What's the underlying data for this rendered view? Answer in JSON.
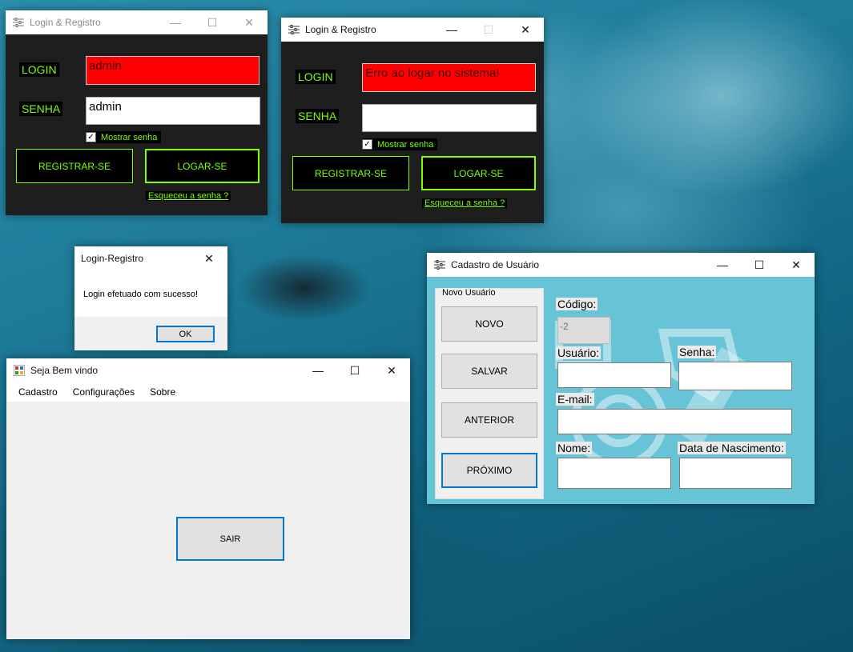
{
  "login1": {
    "title": "Login & Registro",
    "login_label": "LOGIN",
    "senha_label": "SENHA",
    "login_value": "admin",
    "senha_value": "admin",
    "show_password": "Mostrar senha",
    "register": "REGISTRAR-SE",
    "login_btn": "LOGAR-SE",
    "forgot": "Esqueceu a senha ?"
  },
  "login2": {
    "title": "Login & Registro",
    "login_label": "LOGIN",
    "senha_label": "SENHA",
    "login_value": "Erro ao logar no sistema!",
    "senha_value": "",
    "show_password": "Mostrar senha",
    "register": "REGISTRAR-SE",
    "login_btn": "LOGAR-SE",
    "forgot": "Esqueceu a senha ?"
  },
  "msgbox": {
    "title": "Login-Registro",
    "message": "Login efetuado com sucesso!",
    "ok": "OK"
  },
  "welcome": {
    "title": "Seja Bem vindo",
    "menu": [
      "Cadastro",
      "Configurações",
      "Sobre"
    ],
    "exit": "SAIR"
  },
  "cadastro": {
    "title": "Cadastro de Usuário",
    "group_title": "Novo Usuário",
    "buttons": {
      "novo": "NOVO",
      "salvar": "SALVAR",
      "anterior": "ANTERIOR",
      "proximo": "PRÓXIMO"
    },
    "labels": {
      "codigo": "Código:",
      "usuario": "Usuário:",
      "senha": "Senha:",
      "email": "E-mail:",
      "nome": "Nome:",
      "nascimento": "Data de Nascimento:"
    },
    "codigo_value": "-2"
  },
  "colors": {
    "accent_green": "#7fff00",
    "error_red": "#ff0000",
    "focus_blue": "#0078d7",
    "form_bg": "#67c3d6"
  },
  "icons": {
    "window_controls": [
      "minimize-icon",
      "maximize-icon",
      "close-icon"
    ],
    "app_icon": "sliders-icon"
  }
}
